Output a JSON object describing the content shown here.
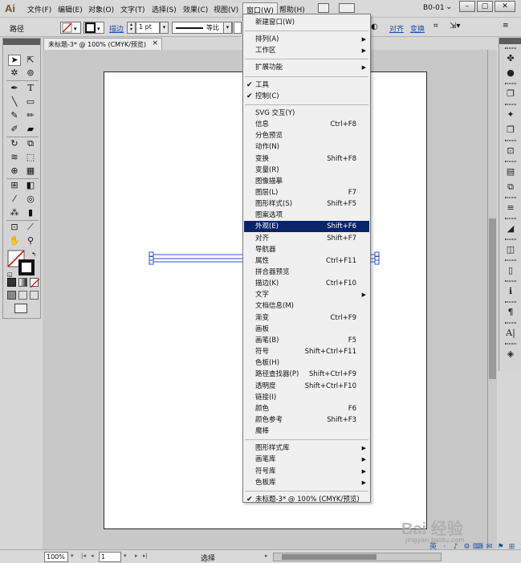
{
  "app": {
    "logo": "Ai"
  },
  "menubar": {
    "items": [
      "文件(F)",
      "编辑(E)",
      "对象(O)",
      "文字(T)",
      "选择(S)",
      "效果(C)",
      "视图(V)",
      "窗口(W)",
      "帮助(H)"
    ],
    "active": "窗口(W)",
    "workspace": "B0-01",
    "workspace_chevron": "⌄"
  },
  "window_controls": {
    "minimize": "–",
    "restore": "▢",
    "close": "✕"
  },
  "controlbar": {
    "selection_type": "路径",
    "stroke_link": "描边",
    "stroke_weight": "1 pt",
    "stroke_profile": "等比",
    "align_link": "对齐",
    "transform_link": "变换"
  },
  "document_tab": {
    "title": "未标题-3* @ 100% (CMYK/预览)",
    "close": "×"
  },
  "window_menu": {
    "items": [
      {
        "label": "新建窗口(W)",
        "shortcut": "",
        "check": false,
        "submenu": false,
        "highlight": false
      },
      {
        "sep": true
      },
      {
        "label": "排列(A)",
        "shortcut": "",
        "check": false,
        "submenu": true,
        "highlight": false
      },
      {
        "label": "工作区",
        "shortcut": "",
        "check": false,
        "submenu": true,
        "highlight": false
      },
      {
        "sep": true
      },
      {
        "label": "扩展功能",
        "shortcut": "",
        "check": false,
        "submenu": true,
        "highlight": false
      },
      {
        "sep": true
      },
      {
        "label": "工具",
        "shortcut": "",
        "check": true,
        "submenu": false,
        "highlight": false
      },
      {
        "label": "控制(C)",
        "shortcut": "",
        "check": true,
        "submenu": false,
        "highlight": false
      },
      {
        "sep": true
      },
      {
        "label": "SVG 交互(Y)",
        "shortcut": "",
        "check": false,
        "submenu": false,
        "highlight": false
      },
      {
        "label": "信息",
        "shortcut": "Ctrl+F8",
        "check": false,
        "submenu": false,
        "highlight": false
      },
      {
        "label": "分色预览",
        "shortcut": "",
        "check": false,
        "submenu": false,
        "highlight": false
      },
      {
        "label": "动作(N)",
        "shortcut": "",
        "check": false,
        "submenu": false,
        "highlight": false
      },
      {
        "label": "变换",
        "shortcut": "Shift+F8",
        "check": false,
        "submenu": false,
        "highlight": false
      },
      {
        "label": "变量(R)",
        "shortcut": "",
        "check": false,
        "submenu": false,
        "highlight": false
      },
      {
        "label": "图像描摹",
        "shortcut": "",
        "check": false,
        "submenu": false,
        "highlight": false
      },
      {
        "label": "图层(L)",
        "shortcut": "F7",
        "check": false,
        "submenu": false,
        "highlight": false
      },
      {
        "label": "图形样式(S)",
        "shortcut": "Shift+F5",
        "check": false,
        "submenu": false,
        "highlight": false
      },
      {
        "label": "图案选项",
        "shortcut": "",
        "check": false,
        "submenu": false,
        "highlight": false
      },
      {
        "label": "外观(E)",
        "shortcut": "Shift+F6",
        "check": false,
        "submenu": false,
        "highlight": true
      },
      {
        "label": "对齐",
        "shortcut": "Shift+F7",
        "check": false,
        "submenu": false,
        "highlight": false
      },
      {
        "label": "导航器",
        "shortcut": "",
        "check": false,
        "submenu": false,
        "highlight": false
      },
      {
        "label": "属性",
        "shortcut": "Ctrl+F11",
        "check": false,
        "submenu": false,
        "highlight": false
      },
      {
        "label": "拼合器预览",
        "shortcut": "",
        "check": false,
        "submenu": false,
        "highlight": false
      },
      {
        "label": "描边(K)",
        "shortcut": "Ctrl+F10",
        "check": false,
        "submenu": false,
        "highlight": false
      },
      {
        "label": "文字",
        "shortcut": "",
        "check": false,
        "submenu": true,
        "highlight": false
      },
      {
        "label": "文档信息(M)",
        "shortcut": "",
        "check": false,
        "submenu": false,
        "highlight": false
      },
      {
        "label": "渐变",
        "shortcut": "Ctrl+F9",
        "check": false,
        "submenu": false,
        "highlight": false
      },
      {
        "label": "画板",
        "shortcut": "",
        "check": false,
        "submenu": false,
        "highlight": false
      },
      {
        "label": "画笔(B)",
        "shortcut": "F5",
        "check": false,
        "submenu": false,
        "highlight": false
      },
      {
        "label": "符号",
        "shortcut": "Shift+Ctrl+F11",
        "check": false,
        "submenu": false,
        "highlight": false
      },
      {
        "label": "色板(H)",
        "shortcut": "",
        "check": false,
        "submenu": false,
        "highlight": false
      },
      {
        "label": "路径查找器(P)",
        "shortcut": "Shift+Ctrl+F9",
        "check": false,
        "submenu": false,
        "highlight": false
      },
      {
        "label": "透明度",
        "shortcut": "Shift+Ctrl+F10",
        "check": false,
        "submenu": false,
        "highlight": false
      },
      {
        "label": "链接(I)",
        "shortcut": "",
        "check": false,
        "submenu": false,
        "highlight": false
      },
      {
        "label": "颜色",
        "shortcut": "F6",
        "check": false,
        "submenu": false,
        "highlight": false
      },
      {
        "label": "颜色参考",
        "shortcut": "Shift+F3",
        "check": false,
        "submenu": false,
        "highlight": false
      },
      {
        "label": "魔棒",
        "shortcut": "",
        "check": false,
        "submenu": false,
        "highlight": false
      },
      {
        "sep": true
      },
      {
        "label": "图形样式库",
        "shortcut": "",
        "check": false,
        "submenu": true,
        "highlight": false
      },
      {
        "label": "画笔库",
        "shortcut": "",
        "check": false,
        "submenu": true,
        "highlight": false
      },
      {
        "label": "符号库",
        "shortcut": "",
        "check": false,
        "submenu": true,
        "highlight": false
      },
      {
        "label": "色板库",
        "shortcut": "",
        "check": false,
        "submenu": true,
        "highlight": false
      },
      {
        "sep": true
      },
      {
        "label": "未标题-3* @ 100% (CMYK/预览)",
        "shortcut": "",
        "check": true,
        "submenu": false,
        "highlight": false
      }
    ]
  },
  "statusbar": {
    "zoom": "100%",
    "artboard_number": "1",
    "current_tool": "选择"
  },
  "watermark": {
    "text": "Bai 经验",
    "url": "jingyan.baidu.com"
  },
  "tray": [
    "英",
    "·",
    "♪",
    "⚙",
    "⌨",
    "✉",
    "⚑",
    "⊞"
  ],
  "colors": {
    "menu_highlight": "#0a246a",
    "link_blue": "#1a4fb5",
    "selection_blue": "#2b4fd8"
  }
}
